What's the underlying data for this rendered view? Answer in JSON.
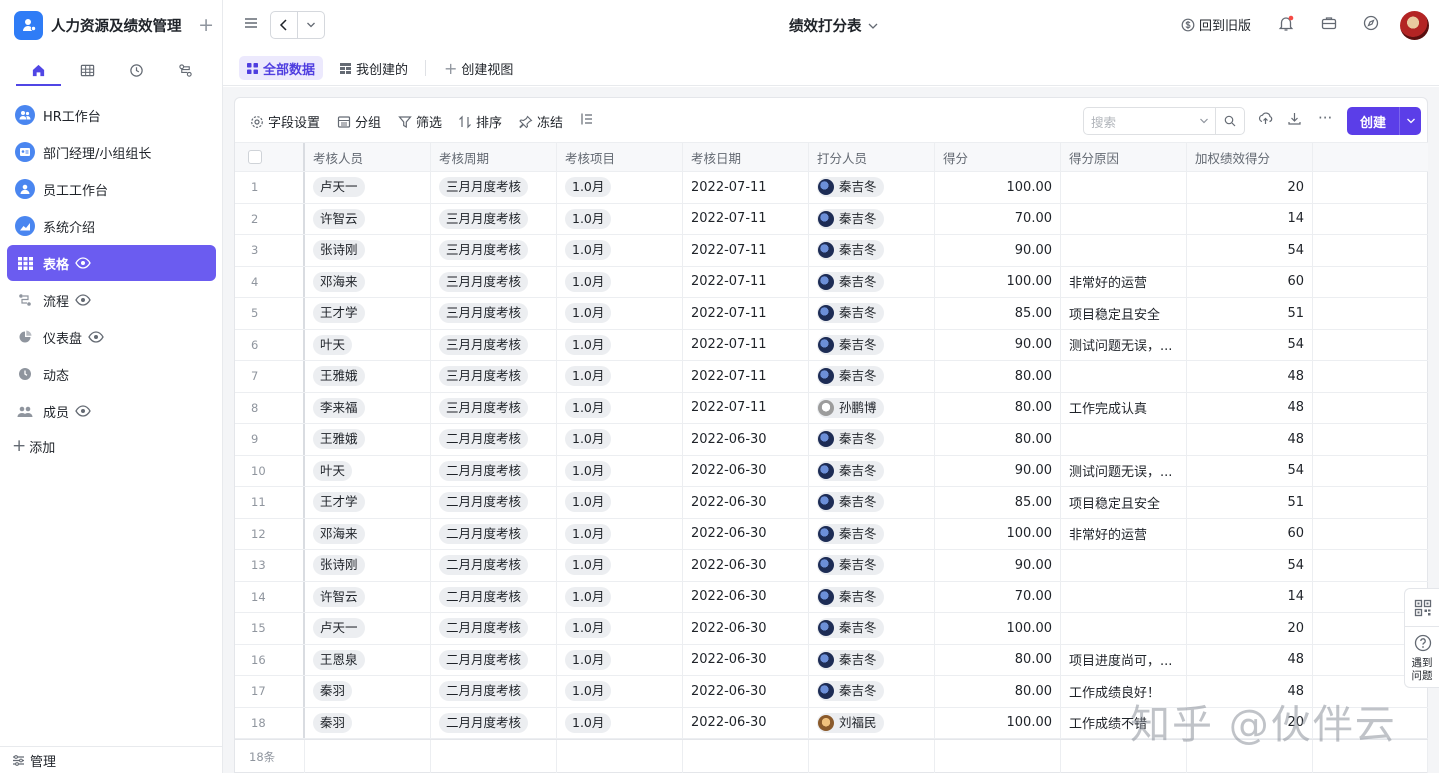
{
  "app": {
    "title": "人力资源及绩效管理"
  },
  "sidebar": {
    "items": [
      {
        "label": "HR工作台"
      },
      {
        "label": "部门经理/小组组长"
      },
      {
        "label": "员工工作台"
      },
      {
        "label": "系统介绍"
      },
      {
        "label": "表格"
      },
      {
        "label": "流程"
      },
      {
        "label": "仪表盘"
      },
      {
        "label": "动态"
      },
      {
        "label": "成员"
      }
    ],
    "add_label": "添加",
    "manage_label": "管理"
  },
  "topbar": {
    "doc_title": "绩效打分表",
    "old_version_label": "回到旧版"
  },
  "views": {
    "all_data": "全部数据",
    "mine": "我创建的",
    "create_view": "创建视图"
  },
  "toolbar": {
    "fields": "字段设置",
    "group": "分组",
    "filter": "筛选",
    "sort": "排序",
    "freeze": "冻结",
    "search_placeholder": "搜索",
    "create": "创建"
  },
  "table": {
    "headers": [
      "考核人员",
      "考核周期",
      "考核项目",
      "考核日期",
      "打分人员",
      "得分",
      "得分原因",
      "加权绩效得分"
    ],
    "rows": [
      [
        "1",
        "卢天一",
        "三月月度考核",
        "1.0月",
        "2022-07-11",
        "秦吉冬",
        "100.00",
        "",
        "20"
      ],
      [
        "2",
        "许智云",
        "三月月度考核",
        "1.0月",
        "2022-07-11",
        "秦吉冬",
        "70.00",
        "",
        "14"
      ],
      [
        "3",
        "张诗刚",
        "三月月度考核",
        "1.0月",
        "2022-07-11",
        "秦吉冬",
        "90.00",
        "",
        "54"
      ],
      [
        "4",
        "邓海来",
        "三月月度考核",
        "1.0月",
        "2022-07-11",
        "秦吉冬",
        "100.00",
        "非常好的运营",
        "60"
      ],
      [
        "5",
        "王才学",
        "三月月度考核",
        "1.0月",
        "2022-07-11",
        "秦吉冬",
        "85.00",
        "项目稳定且安全",
        "51"
      ],
      [
        "6",
        "叶天",
        "三月月度考核",
        "1.0月",
        "2022-07-11",
        "秦吉冬",
        "90.00",
        "测试问题无误，...",
        "54"
      ],
      [
        "7",
        "王雅娥",
        "三月月度考核",
        "1.0月",
        "2022-07-11",
        "秦吉冬",
        "80.00",
        "",
        "48"
      ],
      [
        "8",
        "李来福",
        "三月月度考核",
        "1.0月",
        "2022-07-11",
        "孙鹏博",
        "80.00",
        "工作完成认真",
        "48"
      ],
      [
        "9",
        "王雅娥",
        "二月月度考核",
        "1.0月",
        "2022-06-30",
        "秦吉冬",
        "80.00",
        "",
        "48"
      ],
      [
        "10",
        "叶天",
        "二月月度考核",
        "1.0月",
        "2022-06-30",
        "秦吉冬",
        "90.00",
        "测试问题无误，...",
        "54"
      ],
      [
        "11",
        "王才学",
        "二月月度考核",
        "1.0月",
        "2022-06-30",
        "秦吉冬",
        "85.00",
        "项目稳定且安全",
        "51"
      ],
      [
        "12",
        "邓海来",
        "二月月度考核",
        "1.0月",
        "2022-06-30",
        "秦吉冬",
        "100.00",
        "非常好的运营",
        "60"
      ],
      [
        "13",
        "张诗刚",
        "二月月度考核",
        "1.0月",
        "2022-06-30",
        "秦吉冬",
        "90.00",
        "",
        "54"
      ],
      [
        "14",
        "许智云",
        "二月月度考核",
        "1.0月",
        "2022-06-30",
        "秦吉冬",
        "70.00",
        "",
        "14"
      ],
      [
        "15",
        "卢天一",
        "二月月度考核",
        "1.0月",
        "2022-06-30",
        "秦吉冬",
        "100.00",
        "",
        "20"
      ],
      [
        "16",
        "王恩泉",
        "二月月度考核",
        "1.0月",
        "2022-06-30",
        "秦吉冬",
        "80.00",
        "项目进度尚可，...",
        "48"
      ],
      [
        "17",
        "秦羽",
        "二月月度考核",
        "1.0月",
        "2022-06-30",
        "秦吉冬",
        "80.00",
        "工作成绩良好！",
        "48"
      ],
      [
        "18",
        "秦羽",
        "二月月度考核",
        "1.0月",
        "2022-06-30",
        "刘福民",
        "100.00",
        "工作成绩不错",
        "20"
      ]
    ],
    "footer_count": "18条"
  },
  "float_panel": {
    "help_label": "遇到问题"
  },
  "watermark": "知乎 @伙伴云"
}
